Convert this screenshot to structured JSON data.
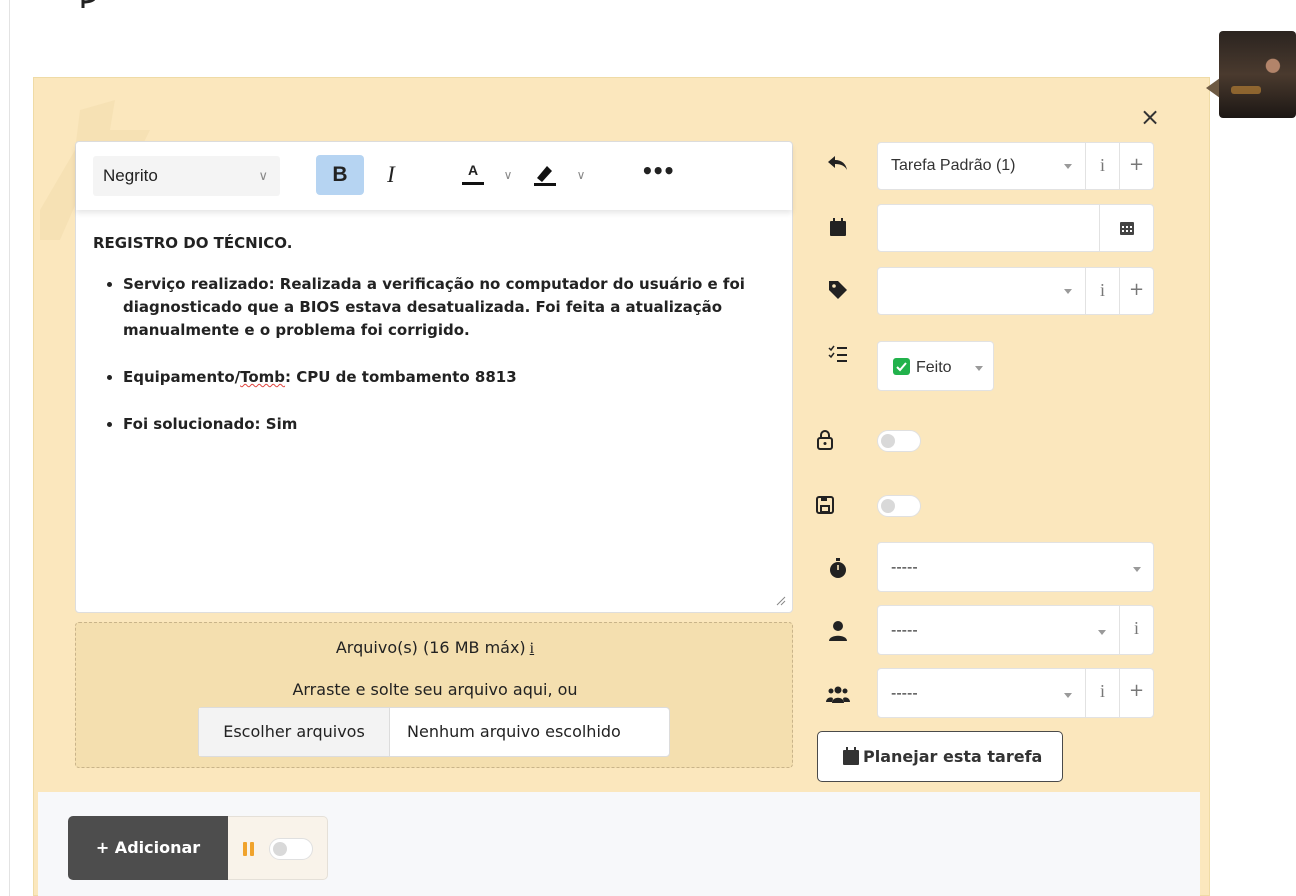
{
  "editor": {
    "format_select": "Negrito",
    "bold_label": "B",
    "italic_label": "I",
    "font_color_label": "A",
    "more_label": "•••",
    "content": {
      "heading": "REGISTRO DO TÉCNICO.",
      "bullets": [
        "Serviço realizado: Realizada a verificação no computador do usuário e foi diagnosticado que a BIOS estava desatualizada. Foi feita a atualização manualmente e o problema foi corrigido.",
        "Equipamento/Tomb: CPU de tombamento 8813",
        "Foi solucionado: Sim"
      ],
      "bullet2_prefix": "Equipamento/",
      "bullet2_misspelled": "Tomb",
      "bullet2_suffix": ": CPU de tombamento 8813"
    }
  },
  "files": {
    "title": "Arquivo(s) (16 MB máx)",
    "info_label": "i",
    "drag_hint": "Arraste e solte seu arquivo aqui, ou",
    "choose_button": "Escolher arquivos",
    "no_file_text": "Nenhum arquivo escolhido"
  },
  "sidebar": {
    "template_select": "Tarefa Padrão (1)",
    "date_value": "",
    "category_value": "",
    "status_label": "Feito",
    "private_toggle": false,
    "save_toggle": false,
    "duration_value": "-----",
    "user_value": "-----",
    "group_value": "-----",
    "info_label": "i",
    "add_label": "+",
    "plan_button": "Planejar esta tarefa"
  },
  "footer": {
    "add_button": "+ Adicionar",
    "pause_toggle": false
  },
  "close_label": "×",
  "colors": {
    "panel_bg": "#fbe7bd",
    "dropzone_bg": "#f4dfaf",
    "bold_active": "#b6d4f2",
    "status_done": "#22b24c",
    "add_button": "#4d4d4d",
    "pause_icon": "#f0a32d"
  }
}
